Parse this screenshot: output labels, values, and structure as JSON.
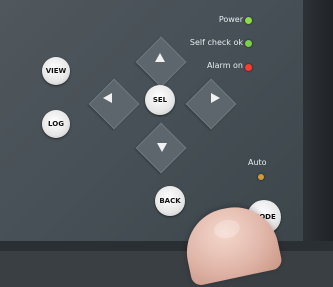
{
  "status": {
    "power": {
      "label": "Power",
      "led_color": "#8bdc4a"
    },
    "self_check": {
      "label": "Self check ok",
      "led_color": "#7bd04a"
    },
    "alarm": {
      "label": "Alarm on",
      "led_color": "#ff3b2f"
    }
  },
  "buttons": {
    "view": "VIEW",
    "log": "LOG",
    "sel": "SEL",
    "back": "BACK",
    "mode": "MODE"
  },
  "auto": {
    "label": "Auto",
    "led_color": "#d39a3a"
  },
  "icons": {
    "up": "up-arrow-icon",
    "down": "down-arrow-icon",
    "left": "left-arrow-icon",
    "right": "right-arrow-icon"
  }
}
